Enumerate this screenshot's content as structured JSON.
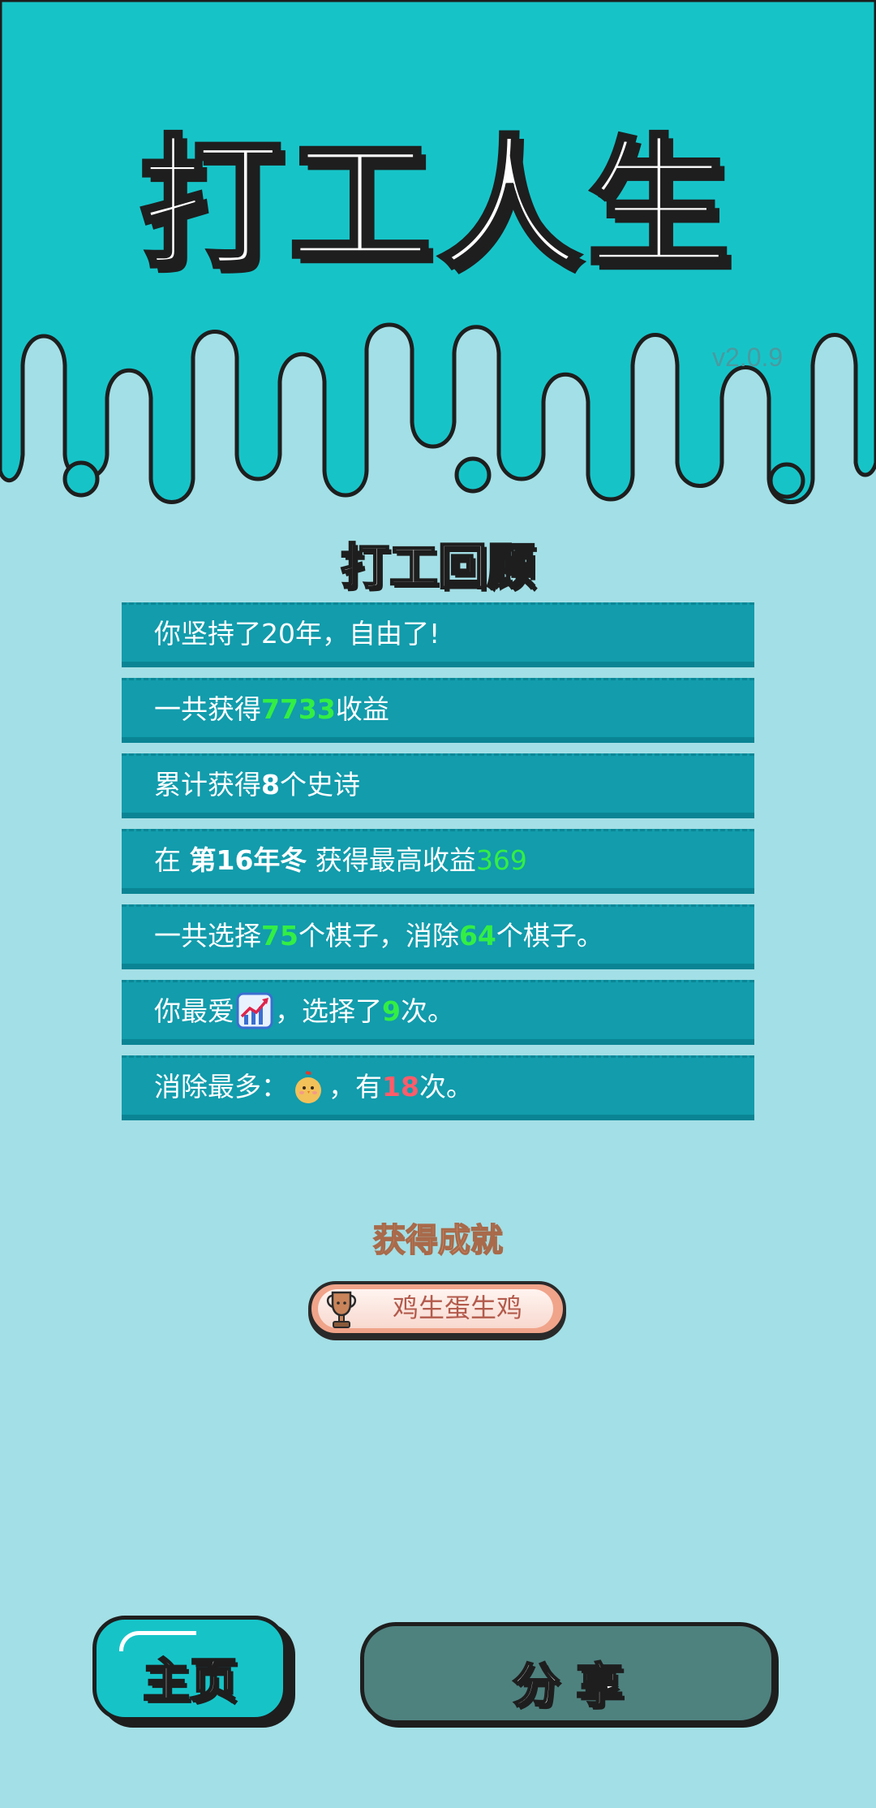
{
  "game": {
    "title": "打工人生",
    "version": "v2.0.9"
  },
  "review": {
    "heading": "打工回顾",
    "rows": {
      "r1": {
        "text": "你坚持了20年，自由了!"
      },
      "r2": {
        "prefix": "一共获得",
        "value": "7733",
        "suffix": "收益"
      },
      "r3": {
        "prefix": "累计获得",
        "value": "8",
        "suffix": "个史诗"
      },
      "r4": {
        "prefix": "在 ",
        "season": "第16年冬",
        "mid": " 获得最高收益",
        "value": "369"
      },
      "r5": {
        "p1": "一共选择",
        "v1": "75",
        "p2": "个棋子，消除",
        "v2": "64",
        "p3": "个棋子。"
      },
      "r6": {
        "prefix": "你最爱",
        "icon": "chart-up-icon",
        "mid": "，选择了",
        "value": "9",
        "suffix": "次。"
      },
      "r7": {
        "prefix": "消除最多：",
        "icon": "chick-icon",
        "mid": "，有",
        "value": "18",
        "suffix": "次。"
      }
    }
  },
  "achievement": {
    "heading": "获得成就",
    "badge_label": "鸡生蛋生鸡",
    "icon": "trophy-icon"
  },
  "buttons": {
    "home_label": "主页",
    "share_label": "分 享"
  },
  "colors": {
    "top_band": "#16c4c8",
    "background": "#a3dfe6",
    "row_bg": "#129cac",
    "highlight_green": "#33ee44",
    "highlight_red": "#ff5c6a",
    "share_button": "#4e827f"
  }
}
